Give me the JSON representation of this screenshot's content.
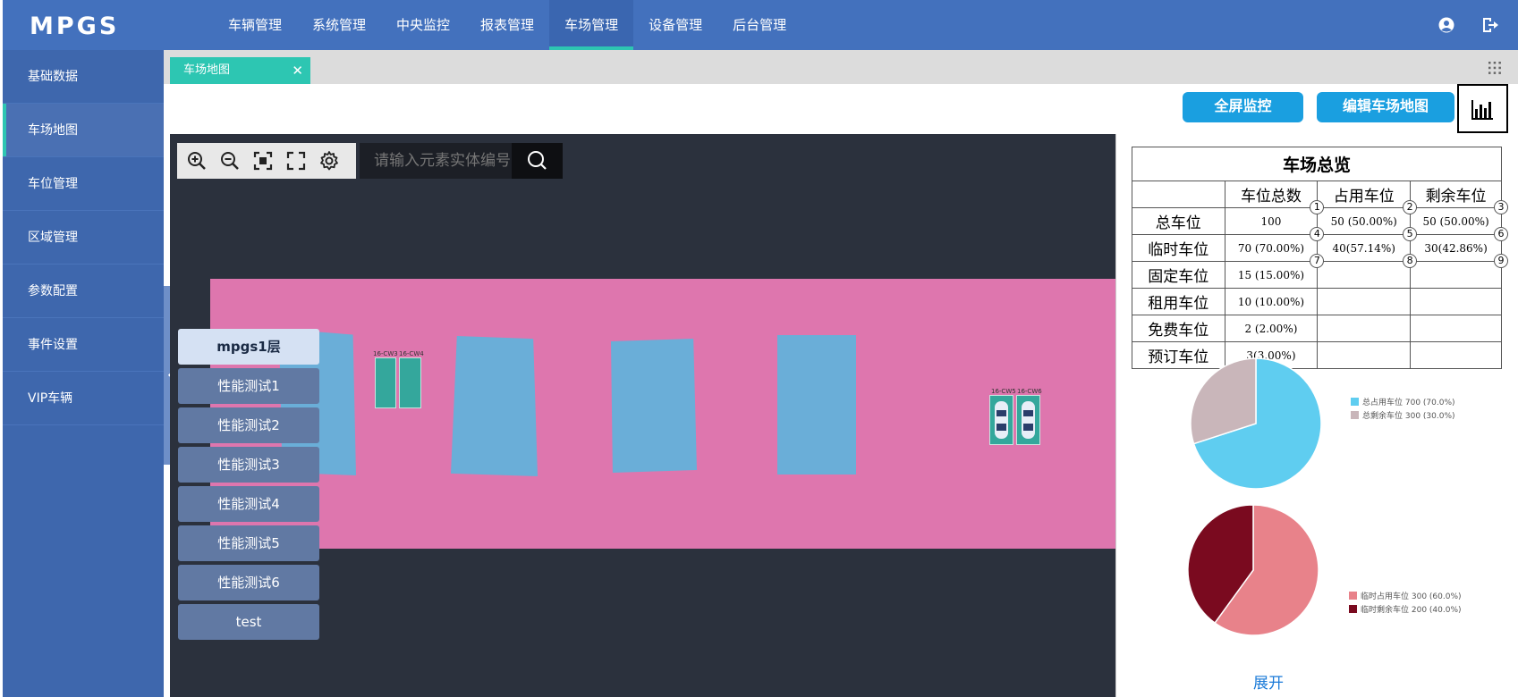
{
  "app": {
    "logo": "MPGS"
  },
  "nav": [
    {
      "label": "车辆管理"
    },
    {
      "label": "系统管理"
    },
    {
      "label": "中央监控"
    },
    {
      "label": "报表管理"
    },
    {
      "label": "车场管理",
      "active": true
    },
    {
      "label": "设备管理"
    },
    {
      "label": "后台管理"
    }
  ],
  "sidebar": [
    {
      "label": "基础数据"
    },
    {
      "label": "车场地图",
      "active": true
    },
    {
      "label": "车位管理"
    },
    {
      "label": "区域管理"
    },
    {
      "label": "参数配置"
    },
    {
      "label": "事件设置"
    },
    {
      "label": "VIP车辆"
    }
  ],
  "tab": {
    "label": "车场地图",
    "close": "✕"
  },
  "toolbar": {
    "fullscreen_label": "全屏监控",
    "edit_label": "编辑车场地图"
  },
  "map": {
    "search_placeholder": "请输入元素实体编号",
    "spot_labels": [
      "16-CW3",
      "16-CW4",
      "16-CW5",
      "16-CW6"
    ]
  },
  "floors": [
    {
      "label": "mpgs1层",
      "active": true
    },
    {
      "label": "性能测试1"
    },
    {
      "label": "性能测试2"
    },
    {
      "label": "性能测试3"
    },
    {
      "label": "性能测试4"
    },
    {
      "label": "性能测试5"
    },
    {
      "label": "性能测试6"
    },
    {
      "label": "test"
    }
  ],
  "overview": {
    "title": "车场总览",
    "headers": [
      "",
      "车位总数",
      "占用车位",
      "剩余车位"
    ],
    "rows": [
      {
        "label": "总车位",
        "cells": [
          "100",
          "50 (50.00%)",
          "50 (50.00%)"
        ],
        "marks": [
          "1",
          "2",
          "3"
        ]
      },
      {
        "label": "临时车位",
        "cells": [
          "70 (70.00%)",
          "40(57.14%)",
          "30(42.86%)"
        ],
        "marks": [
          "4",
          "5",
          "6"
        ]
      },
      {
        "label": "固定车位",
        "cells": [
          "15 (15.00%)",
          "",
          ""
        ],
        "marks": [
          "7",
          "8",
          "9"
        ]
      },
      {
        "label": "租用车位",
        "cells": [
          "10 (10.00%)",
          "",
          ""
        ],
        "marks": []
      },
      {
        "label": "免费车位",
        "cells": [
          "2 (2.00%)",
          "",
          ""
        ],
        "marks": []
      },
      {
        "label": "预订车位",
        "cells": [
          "3(3.00%)",
          "",
          ""
        ],
        "marks": []
      }
    ],
    "expand_label": "展开"
  },
  "chart_data": [
    {
      "type": "pie",
      "categories": [
        "总占用车位 700 (70.0%)",
        "总剩余车位 300 (30.0%)"
      ],
      "values": [
        700,
        300
      ],
      "colors": [
        "#5fcdf0",
        "#c9b6ba"
      ]
    },
    {
      "type": "pie",
      "categories": [
        "临时占用车位 300 (60.0%)",
        "临时剩余车位 200 (40.0%)"
      ],
      "values": [
        300,
        200
      ],
      "colors": [
        "#e8828a",
        "#7a0a1f"
      ]
    }
  ]
}
